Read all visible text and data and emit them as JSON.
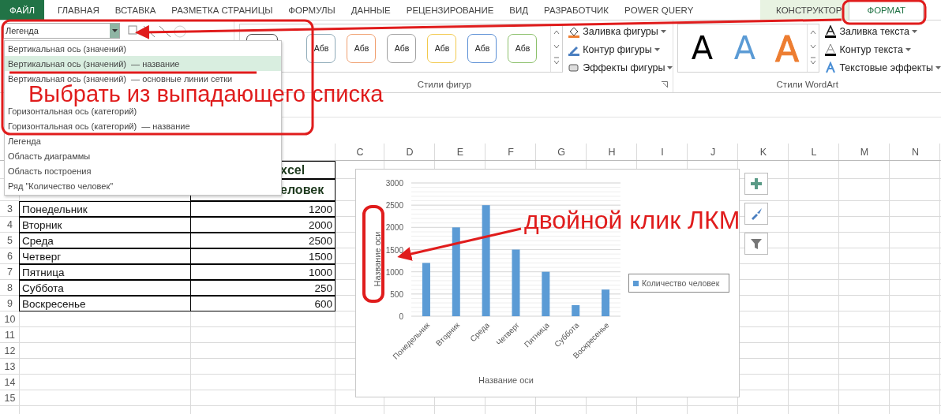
{
  "ribbon_tabs": [
    {
      "label": "ФАЙЛ",
      "kind": "file",
      "selected": false
    },
    {
      "label": "ГЛАВНАЯ",
      "kind": "normal",
      "selected": false
    },
    {
      "label": "ВСТАВКА",
      "kind": "normal",
      "selected": false
    },
    {
      "label": "РАЗМЕТКА СТРАНИЦЫ",
      "kind": "normal",
      "selected": false
    },
    {
      "label": "ФОРМУЛЫ",
      "kind": "normal",
      "selected": false
    },
    {
      "label": "ДАННЫЕ",
      "kind": "normal",
      "selected": false
    },
    {
      "label": "РЕЦЕНЗИРОВАНИЕ",
      "kind": "normal",
      "selected": false
    },
    {
      "label": "ВИД",
      "kind": "normal",
      "selected": false
    },
    {
      "label": "РАЗРАБОТЧИК",
      "kind": "normal",
      "selected": false
    },
    {
      "label": "POWER QUERY",
      "kind": "normal",
      "selected": false
    },
    {
      "label": "КОНСТРУКТОР",
      "kind": "contextual",
      "selected": false
    },
    {
      "label": "ФОРМАТ",
      "kind": "contextual",
      "selected": true
    }
  ],
  "element_selector": {
    "value": "Легенда"
  },
  "element_list": [
    {
      "label": "Вертикальная ось (значений)",
      "selected": false
    },
    {
      "label": "Вертикальная ось (значений)  — название",
      "selected": true
    },
    {
      "label": "Вертикальная ось (значений)  — основные линии сетки",
      "selected": false
    },
    {
      "label": "Горизонтальная ось (категорий)",
      "selected": false
    },
    {
      "label": "Горизонтальная ось (категорий)  — название",
      "selected": false
    },
    {
      "label": "Легенда",
      "selected": false
    },
    {
      "label": "Область диаграммы",
      "selected": false
    },
    {
      "label": "Область построения",
      "selected": false
    },
    {
      "label": "Ряд \"Количество человек\"",
      "selected": false
    }
  ],
  "shape_styles": {
    "label": "Стили фигур",
    "presets": [
      {
        "label": "Абв",
        "color": "#8eaab8"
      },
      {
        "label": "Абв",
        "color": "#f0a070"
      },
      {
        "label": "Абв",
        "color": "#a0a0a0"
      },
      {
        "label": "Абв",
        "color": "#f2c94c"
      },
      {
        "label": "Абв",
        "color": "#5b8fd5"
      },
      {
        "label": "Абв",
        "color": "#8bc06a"
      }
    ],
    "commands": [
      {
        "label": "Заливка фигуры",
        "kind": "fill"
      },
      {
        "label": "Контур фигуры",
        "kind": "outline"
      },
      {
        "label": "Эффекты фигуры",
        "kind": "effects"
      }
    ]
  },
  "wordart_styles": {
    "label": "Стили WordArt",
    "presets": [
      {
        "label": "A",
        "color": "#000000",
        "kind": "solid"
      },
      {
        "label": "A",
        "color": "#5b9bd5",
        "kind": "solid"
      },
      {
        "label": "A",
        "color": "#ed7d31",
        "kind": "outline"
      }
    ],
    "commands": [
      {
        "label": "Заливка текста",
        "kind": "fill"
      },
      {
        "label": "Контур текста",
        "kind": "outline"
      },
      {
        "label": "Текстовые эффекты",
        "kind": "effects"
      }
    ]
  },
  "sheet": {
    "columns": [
      "C",
      "D",
      "E",
      "F",
      "G",
      "H",
      "I",
      "J",
      "K",
      "L",
      "M",
      "N"
    ],
    "title_fragment": "xcel",
    "header_fragment": "еловек",
    "rows": [
      {
        "number": "3",
        "day": "Понедельник",
        "count": "1200"
      },
      {
        "number": "4",
        "day": "Вторник",
        "count": "2000"
      },
      {
        "number": "5",
        "day": "Среда",
        "count": "2500"
      },
      {
        "number": "6",
        "day": "Четверг",
        "count": "1500"
      },
      {
        "number": "7",
        "day": "Пятница",
        "count": "1000"
      },
      {
        "number": "8",
        "day": "Суббота",
        "count": "250"
      },
      {
        "number": "9",
        "day": "Воскресенье",
        "count": "600"
      },
      {
        "number": "10"
      },
      {
        "number": "11"
      },
      {
        "number": "12"
      },
      {
        "number": "13"
      },
      {
        "number": "14"
      },
      {
        "number": "15"
      }
    ]
  },
  "chart": {
    "chart_data": {
      "type": "bar",
      "xlabel": "Название оси",
      "ylabel": "Название оси",
      "categories": [
        "Понедельник",
        "Вторник",
        "Среда",
        "Четверг",
        "Пятница",
        "Суббота",
        "Воскресенье"
      ],
      "series": [
        {
          "name": "Количество человек",
          "color": "#5b9bd5",
          "values": [
            1200,
            2000,
            2500,
            1500,
            1000,
            250,
            600
          ]
        }
      ],
      "ylim": [
        0,
        3000
      ],
      "yticks": [
        0,
        500,
        1000,
        1500,
        2000,
        2500,
        3000
      ],
      "grid": true
    }
  },
  "annotations": [
    {
      "text": "Выбрать из выпадающего списка"
    },
    {
      "text": "двойной клик ЛКМ"
    }
  ]
}
